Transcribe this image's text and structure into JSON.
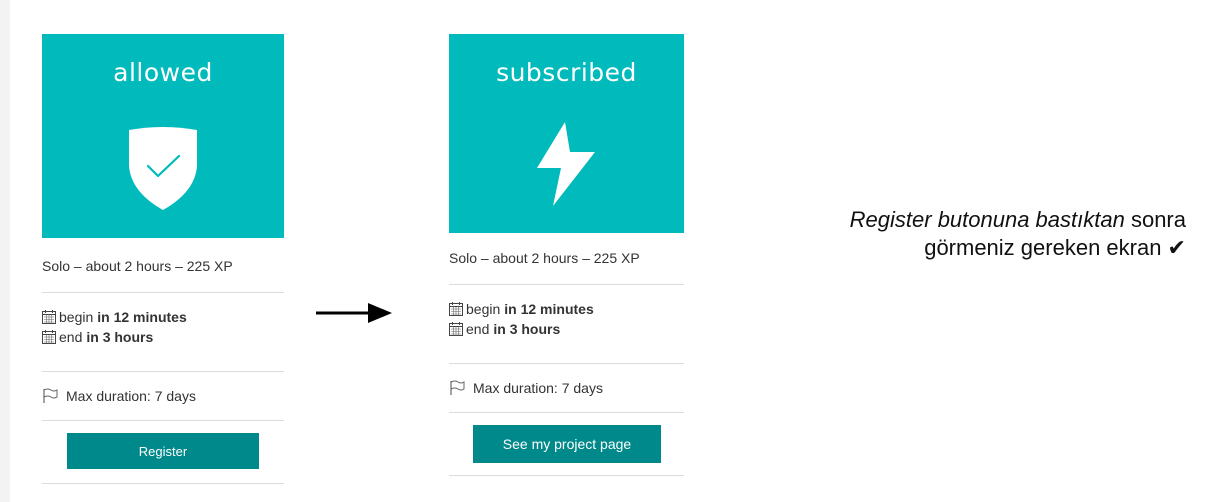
{
  "cards": [
    {
      "banner_title": "allowed",
      "icon": "shield-check-icon",
      "summary": "Solo – about 2 hours – 225 XP",
      "begin_label": "begin",
      "begin_value": "in 12 minutes",
      "end_label": "end",
      "end_value": "in 3 hours",
      "max_duration": "Max duration: 7 days",
      "button_label": "Register"
    },
    {
      "banner_title": "subscribed",
      "icon": "lightning-bolt-icon",
      "summary": "Solo – about 2 hours – 225 XP",
      "begin_label": "begin",
      "begin_value": "in 12 minutes",
      "end_label": "end",
      "end_value": "in 3 hours",
      "max_duration": "Max duration: 7 days",
      "button_label": "See my project page"
    }
  ],
  "note": {
    "italic_part": "Register butonuna bastıktan",
    "rest_line1": " sonra",
    "line2": "görmeniz gereken ekran ✔"
  },
  "colors": {
    "banner": "#00babc",
    "button": "#00898b"
  }
}
